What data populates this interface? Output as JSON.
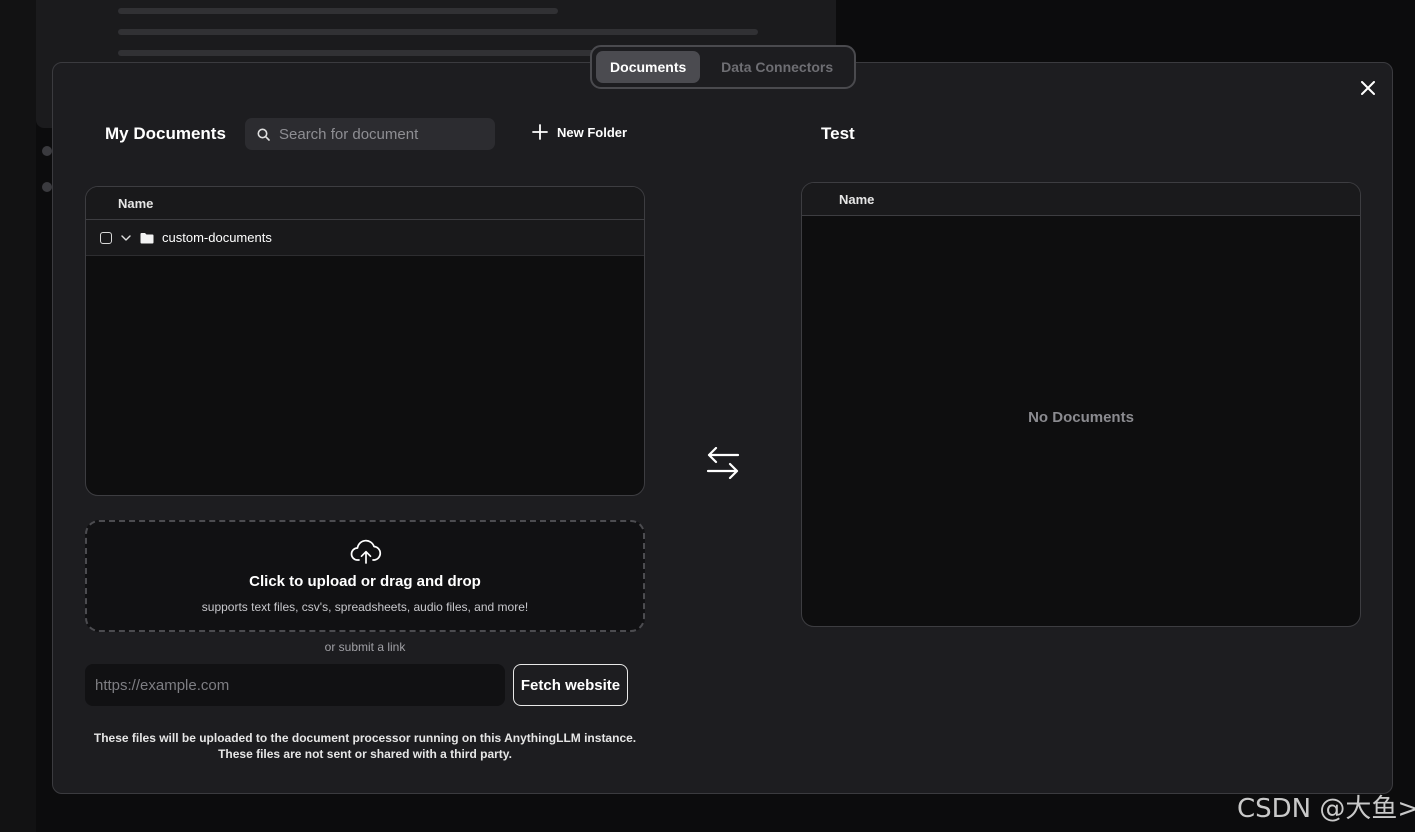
{
  "tabs": [
    {
      "label": "Documents",
      "active": true
    },
    {
      "label": "Data Connectors",
      "active": false
    }
  ],
  "my_documents": {
    "title": "My Documents",
    "search_placeholder": "Search for document",
    "new_folder_label": "New Folder",
    "column_header": "Name",
    "folders": [
      {
        "name": "custom-documents",
        "expanded": true,
        "checked": false
      }
    ]
  },
  "workspace": {
    "title": "Test",
    "column_header": "Name",
    "empty_text": "No Documents"
  },
  "upload": {
    "title": "Click to upload or drag and drop",
    "subtitle": "supports text files, csv's, spreadsheets, audio files, and more!",
    "or_submit": "or submit a link",
    "url_placeholder": "https://example.com",
    "fetch_button": "Fetch website",
    "note_line1": "These files will be uploaded to the document processor running on this AnythingLLM instance.",
    "note_line2": "These files are not sent or shared with a third party."
  },
  "watermark": "CSDN @大鱼>",
  "icons": {
    "close": "close-icon",
    "search": "search-icon",
    "new_folder": "plus-icon",
    "folder": "folder-icon",
    "chevron": "chevron-down-icon",
    "swap": "swap-arrows-icon",
    "upload": "cloud-upload-icon"
  },
  "colors": {
    "modal_bg": "#1d1d20",
    "panel_bg": "#0e0e0f",
    "border": "#3d3d41",
    "active_tab": "#4b4b50",
    "muted_text": "#8b8b90"
  }
}
